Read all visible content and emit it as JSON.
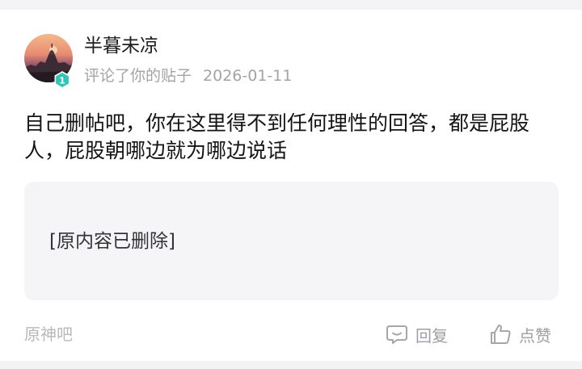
{
  "post": {
    "author": {
      "name": "半暮未凉",
      "level": "1"
    },
    "meta": {
      "action_text": "评论了你的贴子",
      "date": "2026-01-11"
    },
    "reply_text": "自己删帖吧，你在这里得不到任何理性的回答，都是屁股人，屁股朝哪边就为哪边说话",
    "quoted_content": "[原内容已删除]",
    "forum_name": "原神吧",
    "actions": {
      "reply_label": "回复",
      "like_label": "点赞"
    }
  },
  "icons": {
    "reply": "chat-bubble-icon",
    "like": "thumbs-up-icon",
    "badge": "level-badge-icon"
  },
  "colors": {
    "background": "#f3f3f5",
    "card": "#ffffff",
    "badge": "#2fc6b4",
    "muted_text": "#a3a3a8"
  }
}
